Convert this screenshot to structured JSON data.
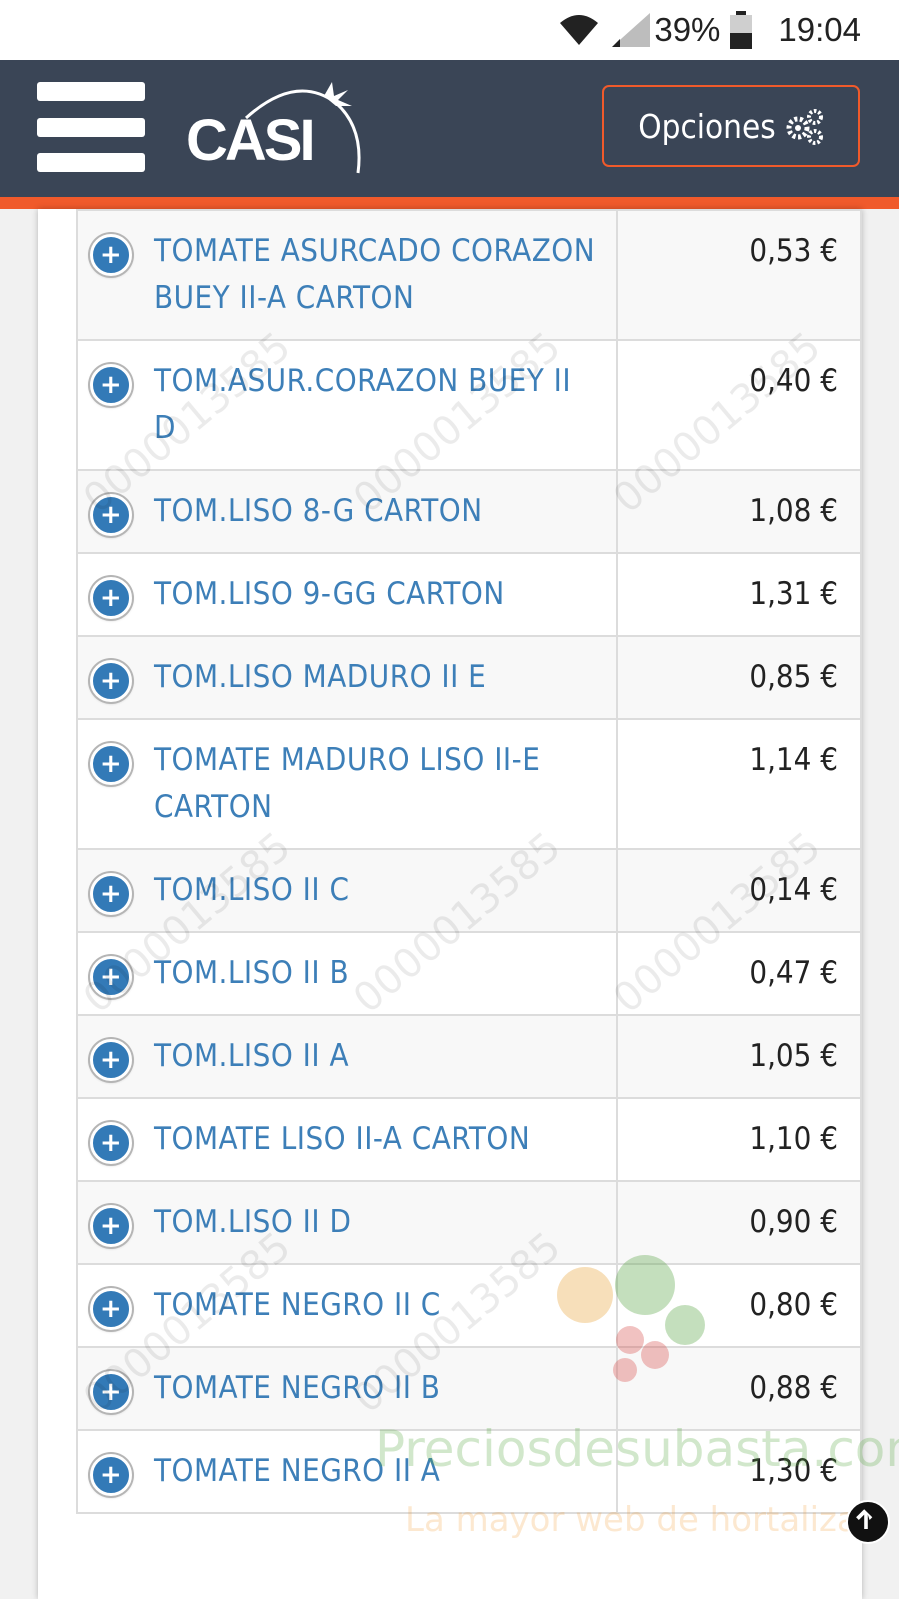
{
  "status_bar": {
    "battery": "39%",
    "time": "19:04"
  },
  "header": {
    "logo_text": "CASI",
    "options_label": "Opciones"
  },
  "products": [
    {
      "name": "TOMATE ASURCADO CORAZON BUEY II-A CARTON",
      "price": "0,53 €"
    },
    {
      "name": "TOM.ASUR.CORAZON BUEY II D",
      "price": "0,40 €"
    },
    {
      "name": "TOM.LISO 8-G CARTON",
      "price": "1,08 €"
    },
    {
      "name": "TOM.LISO 9-GG CARTON",
      "price": "1,31 €"
    },
    {
      "name": "TOM.LISO MADURO II E",
      "price": "0,85 €"
    },
    {
      "name": "TOMATE MADURO LISO II-E CARTON",
      "price": "1,14 €"
    },
    {
      "name": "TOM.LISO II C",
      "price": "0,14 €"
    },
    {
      "name": "TOM.LISO II B",
      "price": "0,47 €"
    },
    {
      "name": "TOM.LISO II A",
      "price": "1,05 €"
    },
    {
      "name": "TOMATE LISO II-A CARTON",
      "price": "1,10 €"
    },
    {
      "name": "TOM.LISO II D",
      "price": "0,90 €"
    },
    {
      "name": "TOMATE NEGRO II C",
      "price": "0,80 €"
    },
    {
      "name": "TOMATE NEGRO II B",
      "price": "0,88 €"
    },
    {
      "name": "TOMATE NEGRO II A",
      "price": "1,30 €"
    }
  ],
  "watermark": {
    "site": "Preciosdesubasta.com",
    "tagline": "La mayor web de hortalizas"
  },
  "colors": {
    "header_bg": "#3a4556",
    "accent": "#f05a2b",
    "link": "#3d7fb8",
    "expand_icon": "#337ab7"
  }
}
